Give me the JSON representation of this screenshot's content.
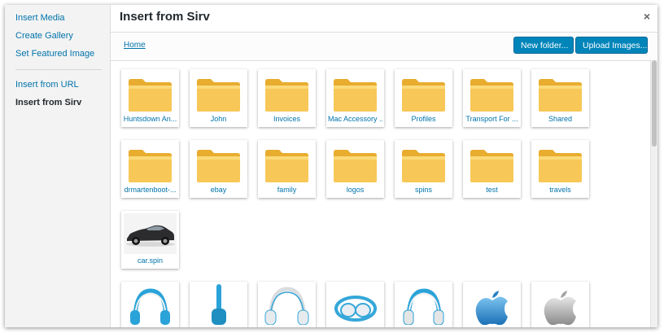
{
  "sidebar": {
    "items": [
      {
        "label": "Insert Media"
      },
      {
        "label": "Create Gallery"
      },
      {
        "label": "Set Featured Image"
      },
      {
        "label": "Insert from URL"
      },
      {
        "label": "Insert from Sirv"
      }
    ]
  },
  "header": {
    "title": "Insert from Sirv",
    "close_icon": "×"
  },
  "toolbar": {
    "breadcrumb": "Home",
    "new_folder": "New folder...",
    "upload_images": "Upload Images..."
  },
  "colors": {
    "accent": "#0085ba",
    "link": "#0073aa",
    "folder": "#f5c24a"
  },
  "folders_row1": [
    "Huntsdown An...",
    "John",
    "Invoices",
    "Mac Accessory ...",
    "Profiles",
    "Transport For ...",
    "Shared"
  ],
  "folders_row2": [
    "drmartenboot-...",
    "ebay",
    "family",
    "logos",
    "spins",
    "test",
    "travels"
  ],
  "files": [
    {
      "label": "car.spin",
      "icon": "car-thumbnail"
    }
  ],
  "images_row": [
    {
      "icon": "blue-headphones-icon"
    },
    {
      "icon": "headphones-side-icon"
    },
    {
      "icon": "white-headphones-icon"
    },
    {
      "icon": "headphones-folded-icon"
    },
    {
      "icon": "blue-headphones-icon"
    },
    {
      "icon": "apple-logo-blue-icon"
    },
    {
      "icon": "apple-logo-silver-icon"
    }
  ]
}
